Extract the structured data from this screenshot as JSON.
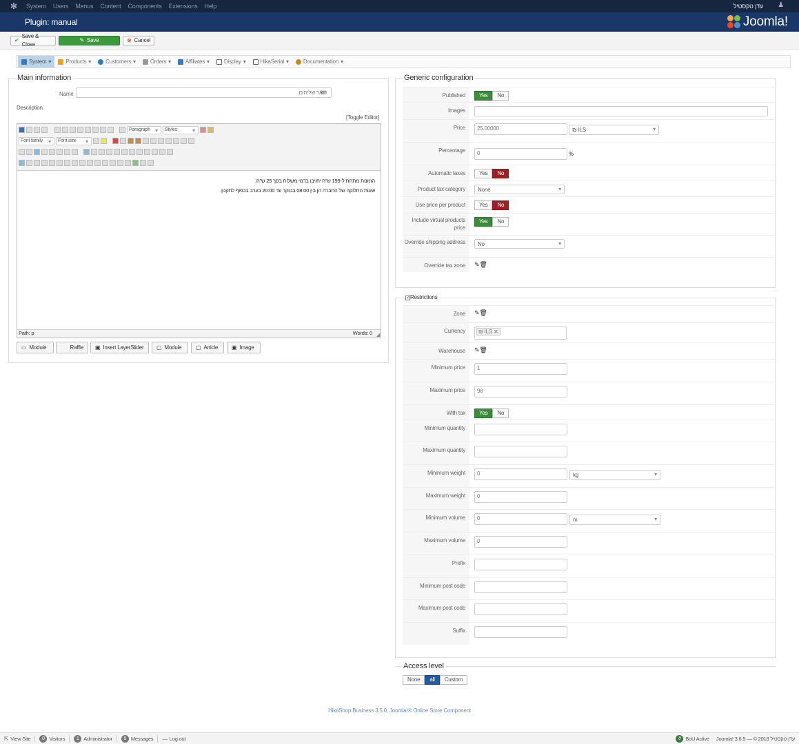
{
  "topbar": {
    "menu": [
      "System",
      "Users",
      "Menus",
      "Content",
      "Components",
      "Extensions",
      "Help"
    ],
    "user": "עדן טקסטיל"
  },
  "header": {
    "title": "Plugin: manual",
    "logo": "Joomla!"
  },
  "toolbar": {
    "save_close": "Save & Close",
    "save": "Save",
    "cancel": "Cancel"
  },
  "hikanav": [
    {
      "label": "System",
      "icon": "wrench-icon",
      "color": "#3a7bbf"
    },
    {
      "label": "Products",
      "icon": "box-icon",
      "color": "#e9a21e"
    },
    {
      "label": "Customers",
      "icon": "users-icon",
      "color": "#2c7dc0"
    },
    {
      "label": "Orders",
      "icon": "cart-icon",
      "color": "#7f7f7f"
    },
    {
      "label": "Affiliates",
      "icon": "affiliates-icon",
      "color": "#3a7bbf"
    },
    {
      "label": "Display",
      "icon": "display-icon",
      "color": "#555"
    },
    {
      "label": "HikaSerial",
      "icon": "serial-icon",
      "color": "#555"
    },
    {
      "label": "Documentation",
      "icon": "lifebuoy-icon",
      "color": "#d08a20"
    }
  ],
  "main": {
    "legend": "Main information",
    "name_label": "Name",
    "name_value": "דואר שליחים",
    "description_label": "Description",
    "toggle": "[Toggle Editor]",
    "editor": {
      "paragraph": "Paragraph",
      "styles": "Styles",
      "font_family": "Font family",
      "font_size": "Font size",
      "line1": "הזמנות מתחת ל-199 ש\"ח יחויבו בדמי משלוח בסך 25 ש\"ח.",
      "line2": "שעות החלוקה של החברה הן בין 08:00 בבוקר עד 20:00 בערב בכפוף לתקנון.",
      "path": "Path: p",
      "words": "Words: 0"
    },
    "buttons": [
      "Module",
      "Raffle",
      "Insert LayerSlider",
      "Module",
      "Article",
      "Image"
    ]
  },
  "generic": {
    "legend": "Generic configuration",
    "published": "Published",
    "images": "Images",
    "price": "Price",
    "price_value": "25.00000",
    "currency": "₪ ILS",
    "percentage": "Percentage",
    "percentage_value": "0",
    "percent": "%",
    "auto_taxes": "Automatic taxes",
    "tax_category": "Product tax category",
    "tax_category_value": "None",
    "use_price_per_product": "Use price per product",
    "include_virtual": "Include virtual products price",
    "override_shipping": "Override shipping address",
    "override_shipping_value": "No",
    "override_tax_zone": "Override tax zone",
    "yes": "Yes",
    "no": "No"
  },
  "restrictions": {
    "legend": "Restrictions",
    "zone": "Zone",
    "currency": "Currency",
    "currency_tag": "₪ ILS",
    "warehouse": "Warehouse",
    "min_price": "Minimum price",
    "min_price_value": "1",
    "max_price": "Maximum price",
    "max_price_value": "98",
    "with_tax": "With tax",
    "min_qty": "Minimum quantity",
    "max_qty": "Maximum quantity",
    "min_weight": "Minimum weight",
    "min_weight_value": "0",
    "weight_unit": "kg",
    "max_weight": "Maximum weight",
    "max_weight_value": "0",
    "min_volume": "Minimum volume",
    "min_volume_value": "0",
    "volume_unit": "m",
    "max_volume": "Maximum volume",
    "max_volume_value": "0",
    "prefix": "Prefix",
    "min_post": "Minimum post code",
    "max_post": "Maximum post code",
    "suffix": "Suffix"
  },
  "access": {
    "legend": "Access level",
    "none": "None",
    "all": "all",
    "custom": "Custom"
  },
  "footer": "HikaShop Business 3.5.0, Joomla!® Online Store Component",
  "statusbar": {
    "view_site": "View Site",
    "visitors": "Visitors",
    "visitors_count": "0",
    "admin": "Administrator",
    "admin_count": "1",
    "messages": "Messages",
    "messages_count": "0",
    "logout": "Log out",
    "bou": "BoU Active",
    "joomla": "Joomla! 3.6.5 — © 2018 עדן טקסטיל"
  }
}
